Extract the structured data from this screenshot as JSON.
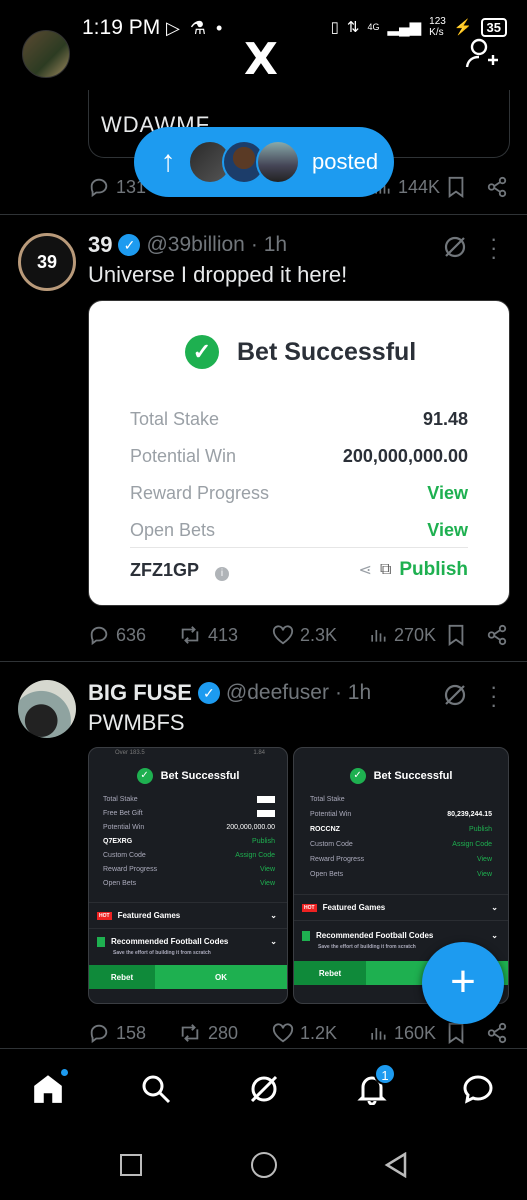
{
  "status_bar": {
    "time": "1:19 PM",
    "network": "4G",
    "speed": "123",
    "speed_unit": "K/s",
    "battery": "35"
  },
  "header": {
    "logo": "X"
  },
  "previous_tweet": {
    "card_text": "WDAWMF",
    "replies": "131",
    "views": "144K"
  },
  "new_posts_pill": {
    "label": "posted"
  },
  "tweets": [
    {
      "avatar_text": "39",
      "name": "39",
      "handle": "@39billion",
      "time": "· 1h",
      "text": "Universe I dropped it here!",
      "bet_card": {
        "title": "Bet Successful",
        "rows": [
          {
            "label": "Total Stake",
            "value": "91.48",
            "green": false
          },
          {
            "label": "Potential Win",
            "value": "200,000,000.00",
            "green": false
          },
          {
            "label": "Reward Progress",
            "value": "View",
            "green": true
          },
          {
            "label": "Open Bets",
            "value": "View",
            "green": true
          }
        ],
        "code": "ZFZ1GP",
        "publish": "Publish"
      },
      "replies": "636",
      "reposts": "413",
      "likes": "2.3K",
      "views": "270K"
    },
    {
      "name": "BIG FUSE",
      "handle": "@deefuser",
      "time": "· 1h",
      "text": "PWMBFS",
      "shots": [
        {
          "top_left": "Over 183.5",
          "top_right": "1.84",
          "title": "Bet Successful",
          "rows": [
            {
              "label": "Total Stake",
              "value": "",
              "kind": "blank"
            },
            {
              "label": "Free Bet Gift",
              "value": "",
              "kind": "blank"
            },
            {
              "label": "Potential Win",
              "value": "200,000,000.00",
              "kind": "plain"
            },
            {
              "label": "Q7EXRG",
              "value": "Publish",
              "kind": "green"
            },
            {
              "label": "Custom Code",
              "value": "Assign Code",
              "kind": "green"
            },
            {
              "label": "Reward Progress",
              "value": "View",
              "kind": "green"
            },
            {
              "label": "Open Bets",
              "value": "View",
              "kind": "green"
            }
          ],
          "featured": "Featured Games",
          "hot": "HOT",
          "recommended": "Recommended Football Codes",
          "recommended_sub": "Save the effort of building it from scratch",
          "rebet": "Rebet",
          "ok": "OK"
        },
        {
          "title": "Bet Successful",
          "rows": [
            {
              "label": "Total Stake",
              "value": "",
              "kind": "none"
            },
            {
              "label": "Potential Win",
              "value": "80,239,244.15",
              "kind": "plain"
            },
            {
              "label": "ROCCNZ",
              "value": "Publish",
              "kind": "green"
            },
            {
              "label": "Custom Code",
              "value": "Assign Code",
              "kind": "green"
            },
            {
              "label": "Reward Progress",
              "value": "View",
              "kind": "green"
            },
            {
              "label": "Open Bets",
              "value": "View",
              "kind": "green"
            }
          ],
          "featured": "Featured Games",
          "hot": "HOT",
          "recommended": "Recommended Football Codes",
          "recommended_sub": "Save the effort of building it from scratch",
          "rebet": "Rebet"
        }
      ],
      "replies": "158",
      "reposts": "280",
      "likes": "1.2K",
      "views": "160K"
    }
  ],
  "fab": {
    "label": "+"
  },
  "bottom_nav": {
    "notifications_badge": "1"
  },
  "colors": {
    "accent": "#1d9bf0",
    "success": "#1eb050",
    "background": "#000000"
  }
}
